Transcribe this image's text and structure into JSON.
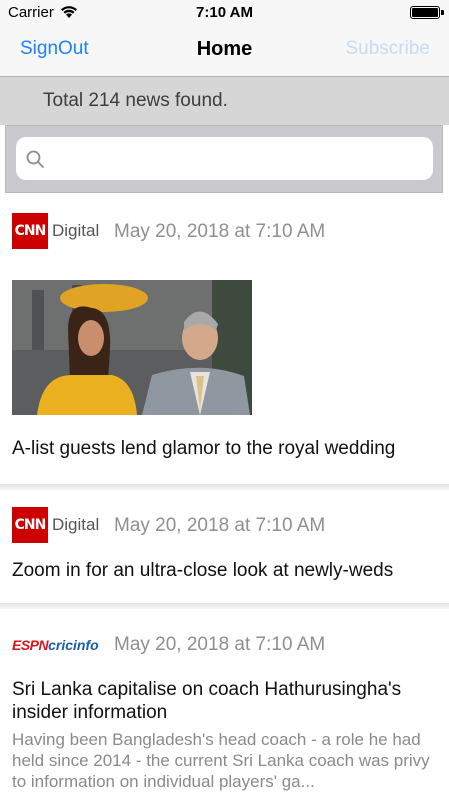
{
  "status_bar": {
    "carrier": "Carrier",
    "time": "7:10 AM",
    "battery_level": 1.0
  },
  "nav": {
    "left_label": "SignOut",
    "title": "Home",
    "right_label": "Subscribe"
  },
  "summary": {
    "count_text": "Total 214 news found."
  },
  "search": {
    "placeholder": "",
    "value": ""
  },
  "colors": {
    "accent": "#1a82fb",
    "accent_disabled": "#c5dcf7",
    "cnn_red": "#cc0000",
    "espn_red": "#d8141d",
    "espn_blue": "#1a5fa8"
  },
  "feed": {
    "items": [
      {
        "source": {
          "brand": "CNN",
          "suffix": "Digital"
        },
        "date": "May 20, 2018 at 7:10 AM",
        "has_image": true,
        "title": "A-list guests lend glamor to the royal wedding",
        "summary": ""
      },
      {
        "source": {
          "brand": "CNN",
          "suffix": "Digital"
        },
        "date": "May 20, 2018 at 7:10 AM",
        "has_image": false,
        "title": "Zoom in for an ultra-close look at newly-weds",
        "summary": ""
      },
      {
        "source": {
          "brand": "ESPN",
          "suffix": "cricinfo"
        },
        "date": "May 20, 2018 at 7:10 AM",
        "has_image": false,
        "title": "Sri Lanka capitalise on coach Hathurusingha's insider information",
        "summary": "Having been Bangladesh's head coach - a role he had held since 2014 - the current Sri Lanka coach was privy to information on individual players' ga..."
      }
    ]
  }
}
